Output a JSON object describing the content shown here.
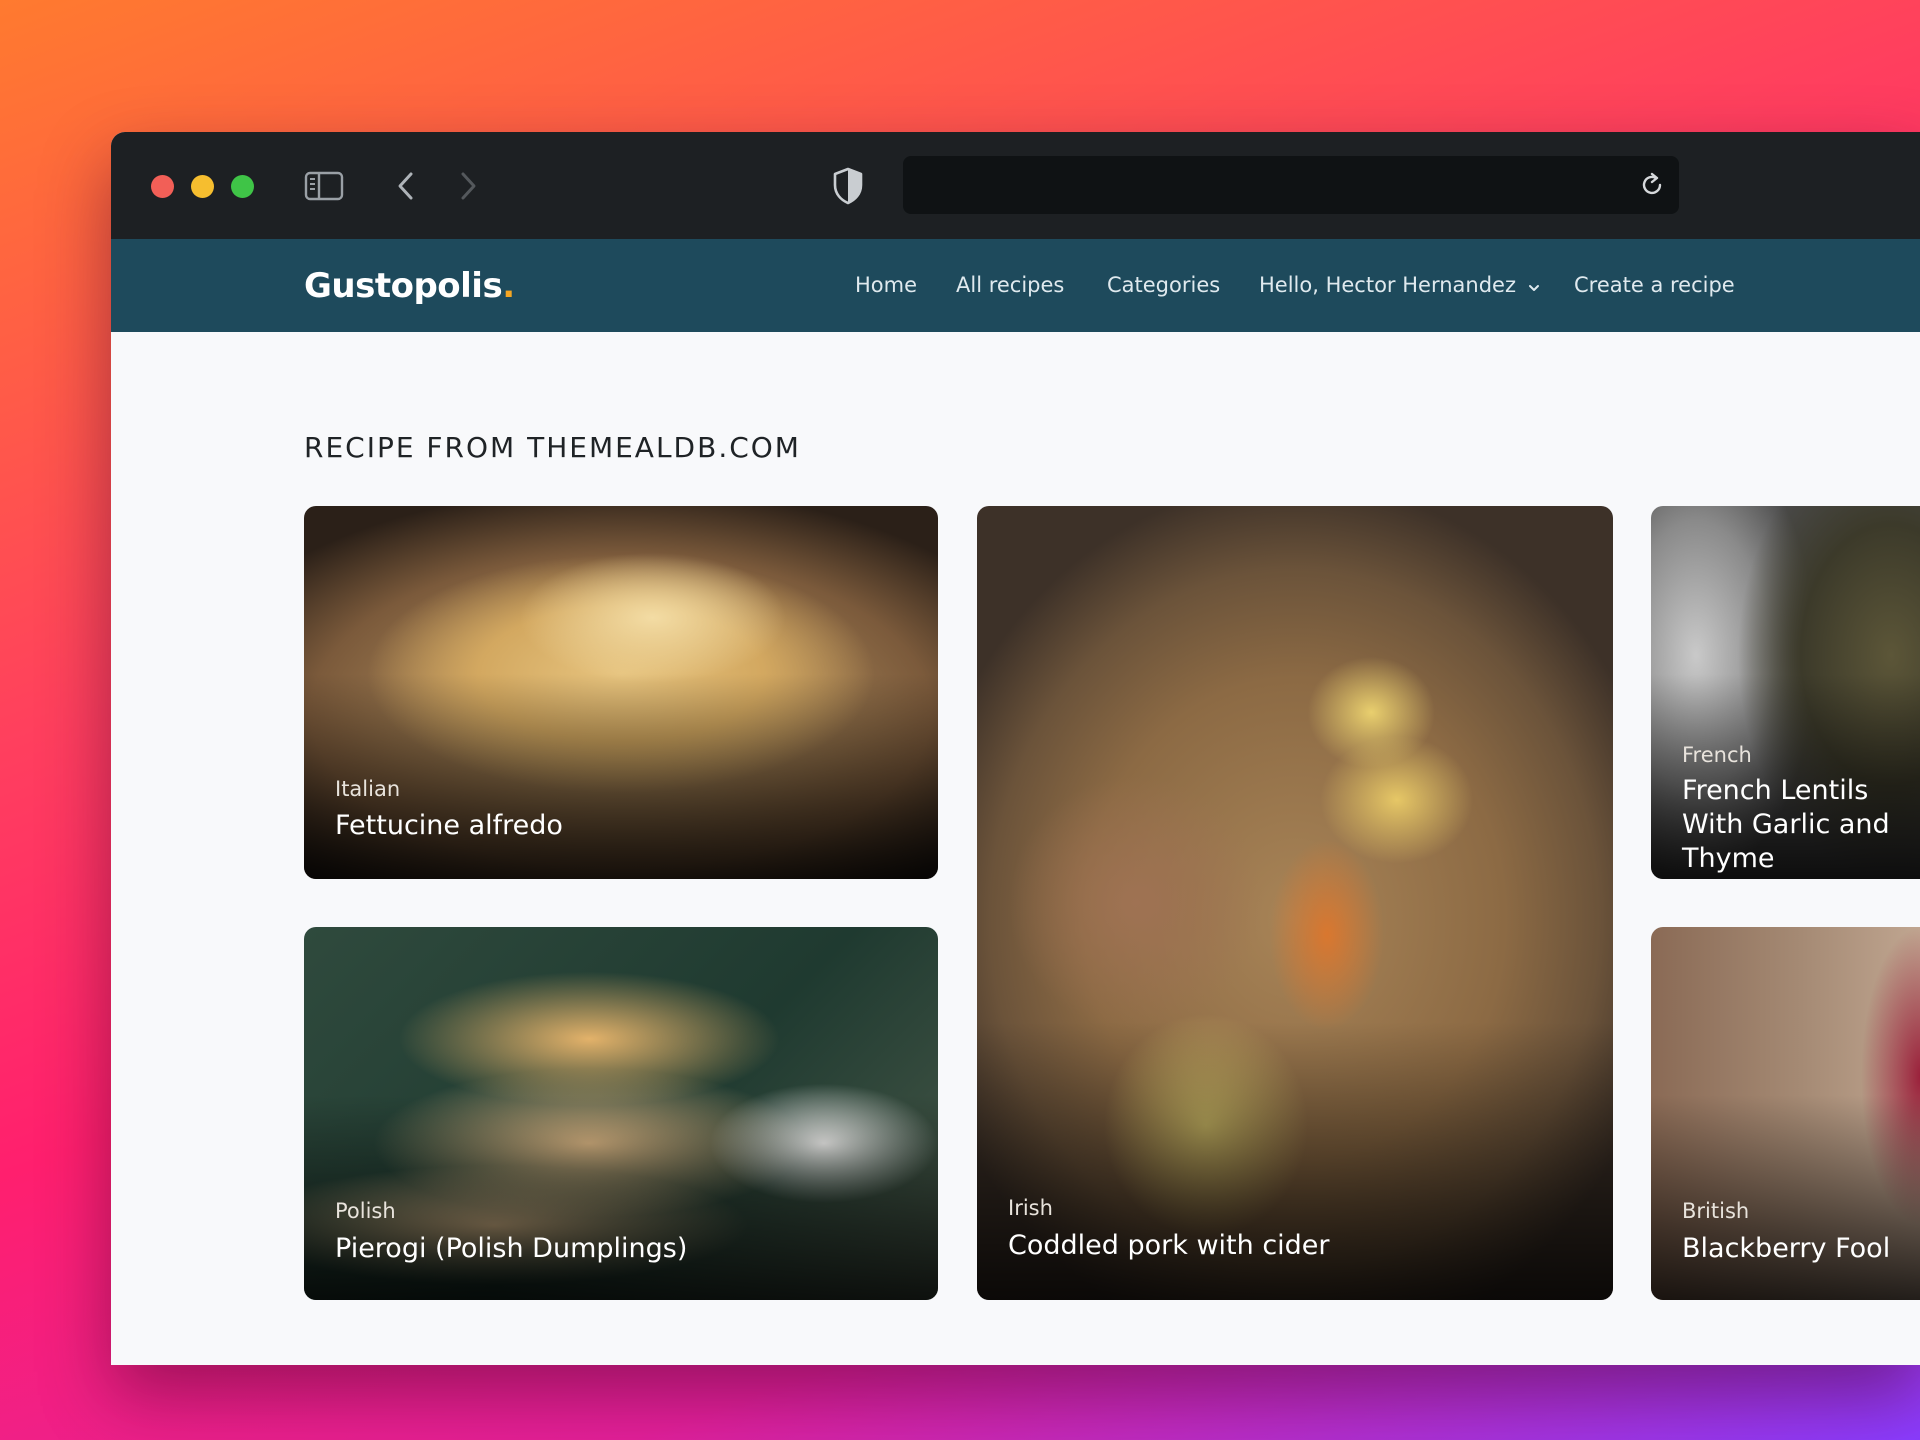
{
  "app": {
    "logo_text": "Gustopolis",
    "logo_dot": "."
  },
  "nav": {
    "home": "Home",
    "all_recipes": "All recipes",
    "categories": "Categories",
    "user_menu": "Hello, Hector Hernandez",
    "create": "Create a recipe"
  },
  "section": {
    "title": "RECIPE FROM THEMEALDB.COM"
  },
  "recipes": [
    {
      "category": "Italian",
      "name": "Fettucine alfredo"
    },
    {
      "category": "Irish",
      "name": "Coddled pork with cider"
    },
    {
      "category": "French",
      "name": "French Lentils With Garlic and Thyme"
    },
    {
      "category": "Polish",
      "name": "Pierogi (Polish Dumplings)"
    },
    {
      "category": "British",
      "name": "Blackberry Fool"
    }
  ],
  "icons": {
    "window_controls": [
      "close-dot",
      "minimize-dot",
      "maximize-dot"
    ],
    "toolbar": [
      "sidebar-icon",
      "back-icon",
      "forward-icon",
      "shield-icon",
      "reload-icon"
    ],
    "nav": [
      "chevron-down-icon"
    ]
  },
  "colors": {
    "navbar": "#1e4a5c",
    "chrome": "#1d2023",
    "page_background": "#f8f9fb",
    "logo_dot": "#f5a623"
  }
}
